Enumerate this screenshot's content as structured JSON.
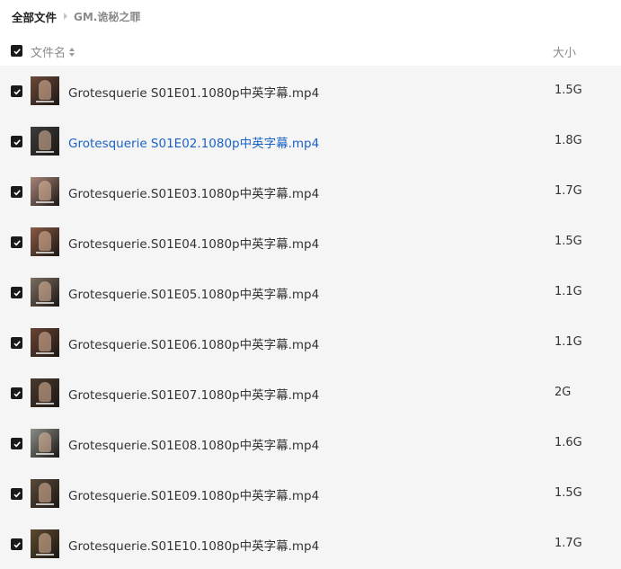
{
  "breadcrumb": {
    "root": "全部文件",
    "current": "GM.诡秘之罪"
  },
  "header": {
    "name_label": "文件名",
    "size_label": "大小"
  },
  "files": [
    {
      "name": "Grotesquerie S01E01.1080p中英字幕.mp4",
      "size": "1.5G",
      "checked": true,
      "active": false,
      "thumb": "#6b4a3a"
    },
    {
      "name": "Grotesquerie S01E02.1080p中英字幕.mp4",
      "size": "1.8G",
      "checked": true,
      "active": true,
      "thumb": "#3c3c3c"
    },
    {
      "name": "Grotesquerie.S01E03.1080p中英字幕.mp4",
      "size": "1.7G",
      "checked": true,
      "active": false,
      "thumb": "#a8877a"
    },
    {
      "name": "Grotesquerie.S01E04.1080p中英字幕.mp4",
      "size": "1.5G",
      "checked": true,
      "active": false,
      "thumb": "#8a5a45"
    },
    {
      "name": "Grotesquerie.S01E05.1080p中英字幕.mp4",
      "size": "1.1G",
      "checked": true,
      "active": false,
      "thumb": "#7c6f62"
    },
    {
      "name": "Grotesquerie.S01E06.1080p中英字幕.mp4",
      "size": "1.1G",
      "checked": true,
      "active": false,
      "thumb": "#6a4434"
    },
    {
      "name": "Grotesquerie.S01E07.1080p中英字幕.mp4",
      "size": "2G",
      "checked": true,
      "active": false,
      "thumb": "#4a3a2e"
    },
    {
      "name": "Grotesquerie.S01E08.1080p中英字幕.mp4",
      "size": "1.6G",
      "checked": true,
      "active": false,
      "thumb": "#8b8f88"
    },
    {
      "name": "Grotesquerie.S01E09.1080p中英字幕.mp4",
      "size": "1.5G",
      "checked": true,
      "active": false,
      "thumb": "#5a4a3a"
    },
    {
      "name": "Grotesquerie.S01E10.1080p中英字幕.mp4",
      "size": "1.7G",
      "checked": true,
      "active": false,
      "thumb": "#5d4a30"
    }
  ],
  "colors": {
    "accent": "#1a63c5",
    "row_background": "#f5f5f5",
    "checkbox": "#1a1a1a"
  }
}
